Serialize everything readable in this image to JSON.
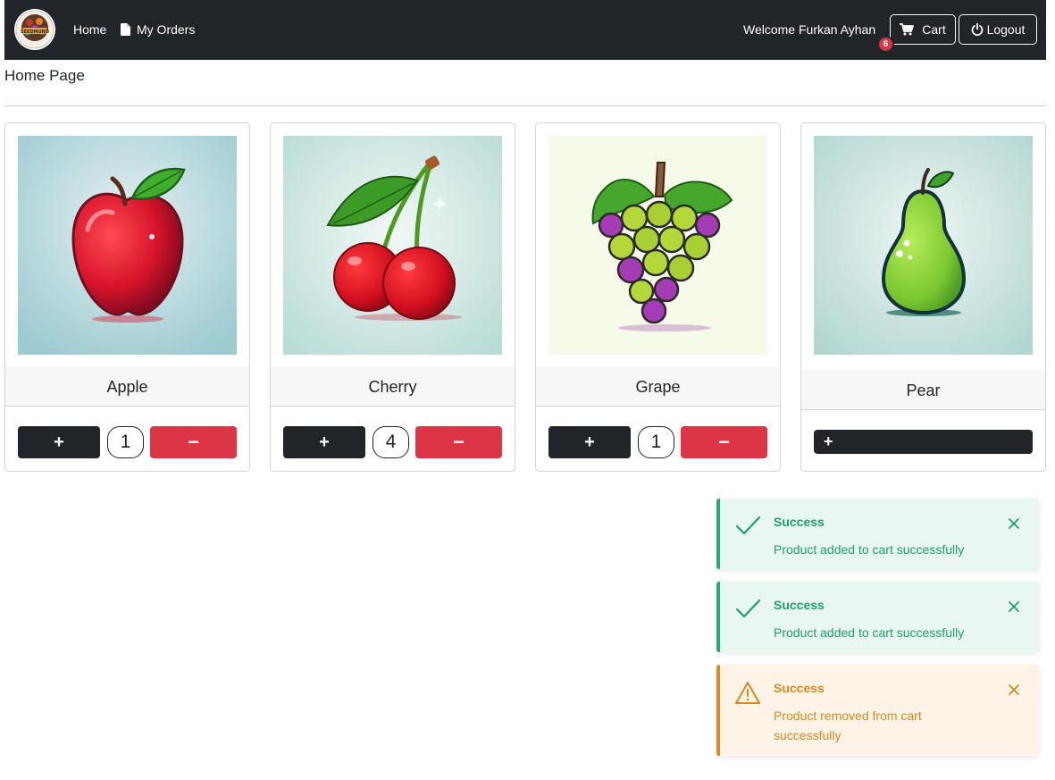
{
  "navbar": {
    "logo_text": "SEEDMUND",
    "home_label": "Home",
    "orders_label": "My Orders",
    "welcome_text": "Welcome Furkan Ayhan",
    "cart_label": "Cart",
    "cart_count": "6",
    "logout_label": "Logout"
  },
  "page": {
    "title": "Home Page"
  },
  "products": [
    {
      "name": "Apple",
      "quantity": "1",
      "plus_label": "+",
      "minus_label": "−"
    },
    {
      "name": "Cherry",
      "quantity": "4",
      "plus_label": "+",
      "minus_label": "−"
    },
    {
      "name": "Grape",
      "quantity": "1",
      "plus_label": "+",
      "minus_label": "−"
    },
    {
      "name": "Pear",
      "plus_label": "+"
    }
  ],
  "toasts": [
    {
      "type": "success",
      "title": "Success",
      "message": "Product added to cart successfully"
    },
    {
      "type": "success",
      "title": "Success",
      "message": "Product added to cart successfully"
    },
    {
      "type": "warning",
      "title": "Success",
      "message": "Product removed from cart successfully"
    }
  ],
  "colors": {
    "navbar_bg": "#212529",
    "danger": "#dc3545",
    "success_toast": "#2aa876",
    "warning_toast": "#d48e2a"
  }
}
